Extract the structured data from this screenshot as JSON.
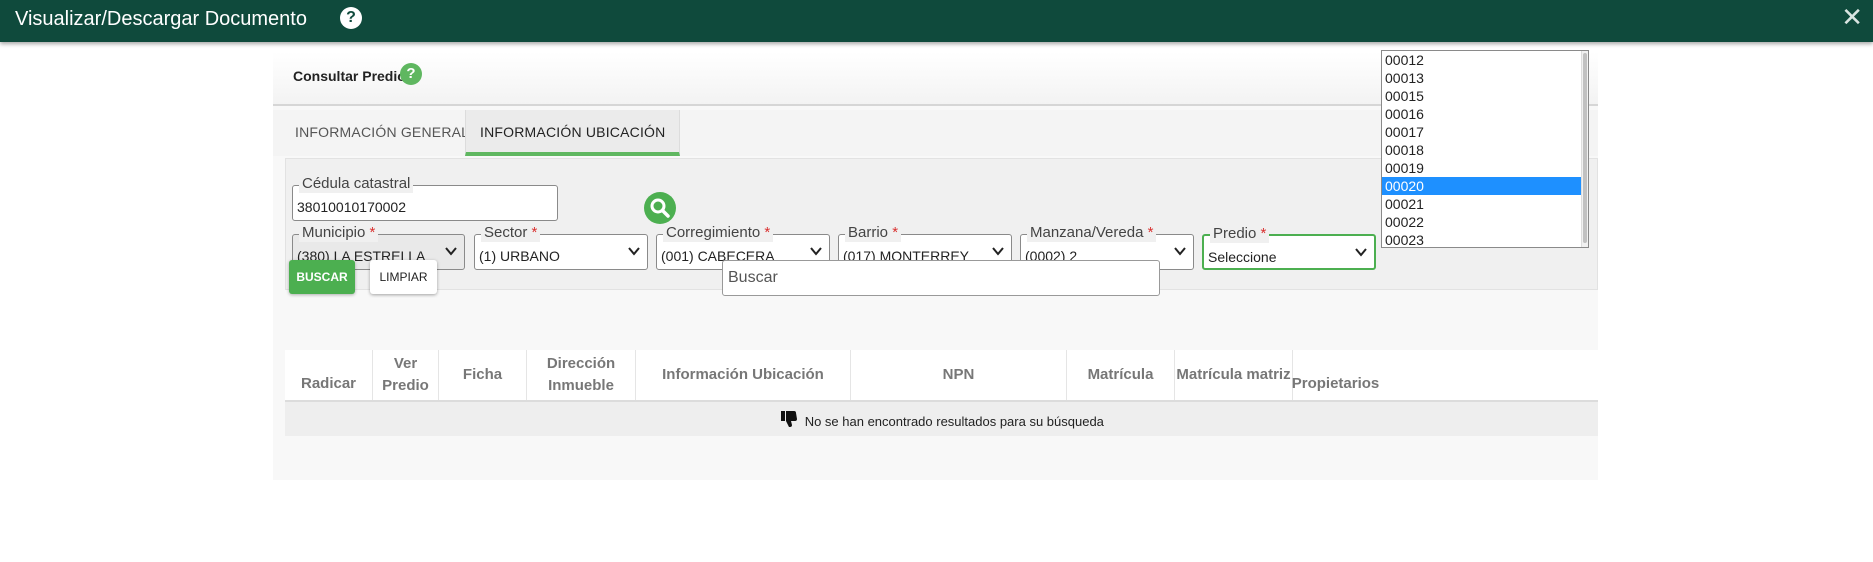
{
  "window": {
    "title": "Visualizar/Descargar Documento",
    "help_glyph": "?",
    "close_glyph": "✕"
  },
  "panel": {
    "title": "Consultar Predio",
    "help_glyph": "?"
  },
  "tabs": [
    {
      "label": "INFORMACIÓN GENERAL"
    },
    {
      "label": "INFORMACIÓN UBICACIÓN"
    }
  ],
  "form": {
    "cedula": {
      "label": "Cédula catastral",
      "value": "38010010170002"
    },
    "municipio": {
      "label": "Municipio",
      "required": "*",
      "value": "(380) LA ESTRELLA"
    },
    "sector": {
      "label": "Sector",
      "required": "*",
      "value": "(1) URBANO"
    },
    "corregimiento": {
      "label": "Corregimiento",
      "required": "*",
      "value": "(001) CABECERA"
    },
    "barrio": {
      "label": "Barrio",
      "required": "*",
      "value": "(017) MONTERREY"
    },
    "manzana": {
      "label": "Manzana/Vereda",
      "required": "*",
      "value": "(0002) 2"
    },
    "predio": {
      "label": "Predio",
      "required": "*",
      "value": "Seleccione"
    }
  },
  "predio_options": [
    "00012",
    "00013",
    "00015",
    "00016",
    "00017",
    "00018",
    "00019",
    "00020",
    "00021",
    "00022",
    "00023"
  ],
  "predio_highlighted": "00020",
  "actions": {
    "buscar": "BUSCAR",
    "limpiar": "LIMPIAR",
    "search_placeholder": "Buscar"
  },
  "table": {
    "columns": [
      "Radicar",
      "Ver Predio",
      "Ficha",
      "Dirección Inmueble",
      "Información Ubicación",
      "NPN",
      "Matrícula",
      "Matrícula matriz",
      "Propietarios"
    ],
    "empty_message": "No se han encontrado resultados para su búsqueda"
  },
  "colors": {
    "titlebar": "#0f4a3c",
    "accent_green": "#4caf50",
    "selected_option": "#1e90ff",
    "required": "#d9302f"
  }
}
